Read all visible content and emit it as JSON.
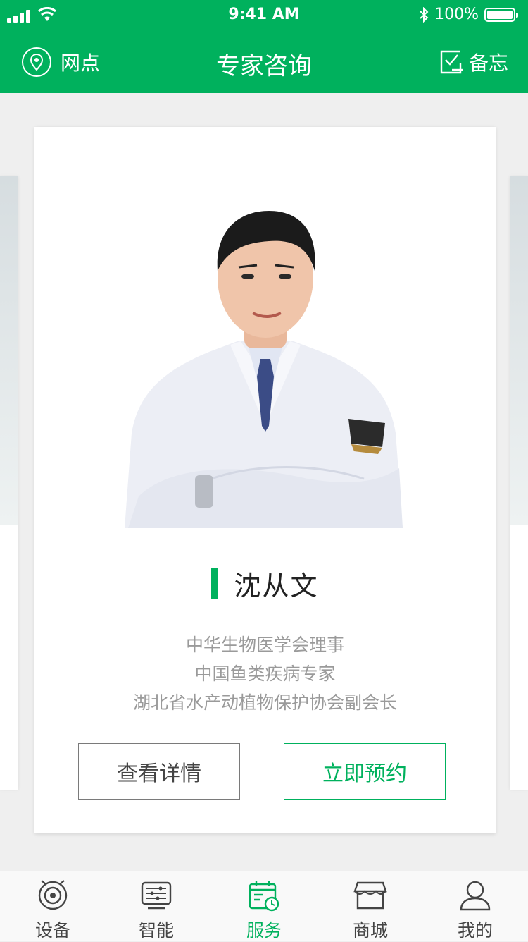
{
  "status_bar": {
    "time": "9:41 AM",
    "battery": "100%"
  },
  "nav": {
    "title": "专家咨询",
    "left_label": "网点",
    "right_label": "备忘"
  },
  "expert": {
    "name": "沈从文",
    "titles": [
      "中华生物医学会理事",
      "中国鱼类疾病专家",
      "湖北省水产动植物保护协会副会长"
    ],
    "detail_button": "查看详情",
    "book_button": "立即预约"
  },
  "tabs": [
    {
      "label": "设备",
      "icon": "device-icon",
      "active": false
    },
    {
      "label": "智能",
      "icon": "smart-icon",
      "active": false
    },
    {
      "label": "服务",
      "icon": "service-calendar-icon",
      "active": true
    },
    {
      "label": "商城",
      "icon": "shop-icon",
      "active": false
    },
    {
      "label": "我的",
      "icon": "profile-icon",
      "active": false
    }
  ],
  "colors": {
    "brand": "#00b15d",
    "background": "#efefef"
  }
}
